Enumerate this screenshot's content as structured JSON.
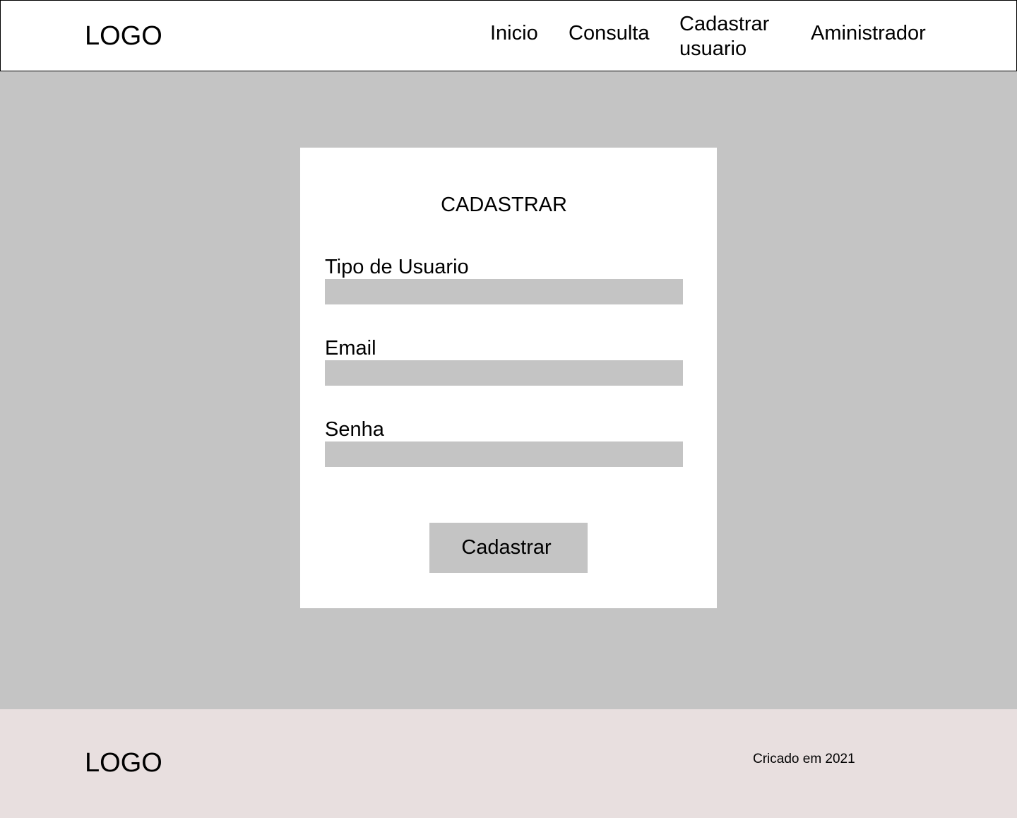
{
  "header": {
    "logo": "LOGO",
    "nav": {
      "inicio": "Inicio",
      "consulta": "Consulta",
      "cadastrar_usuario": "Cadastrar usuario",
      "administrador": "Aministrador"
    }
  },
  "form": {
    "title": "CADASTRAR",
    "fields": {
      "tipo_usuario": {
        "label": "Tipo de Usuario",
        "value": ""
      },
      "email": {
        "label": "Email",
        "value": ""
      },
      "senha": {
        "label": "Senha",
        "value": ""
      }
    },
    "submit_label": "Cadastrar"
  },
  "footer": {
    "logo": "LOGO",
    "text": "Cricado em 2021"
  },
  "colors": {
    "background": "#c4c4c4",
    "card": "#ffffff",
    "input": "#c4c4c4",
    "footer": "#e8dfdf",
    "text": "#000000"
  }
}
